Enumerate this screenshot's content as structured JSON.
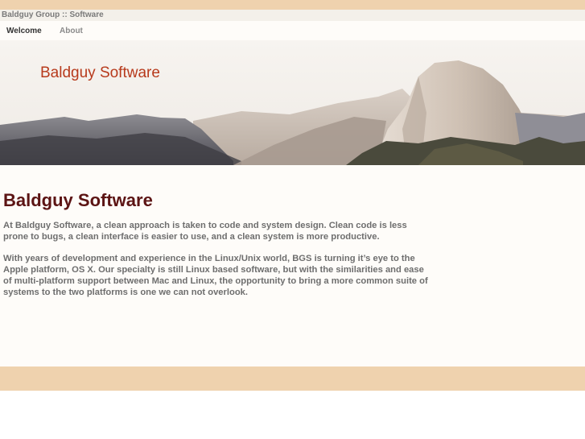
{
  "breadcrumb": "Baldguy Group :: Software",
  "nav": {
    "items": [
      "Welcome",
      "About"
    ]
  },
  "banner": {
    "title": "Baldguy Software"
  },
  "main": {
    "heading": "Baldguy Software",
    "paragraphs": [
      "At Baldguy Software, a clean approach is taken to code and system design. Clean code is less prone to bugs, a clean interface is easier to use, and a clean system is more productive.",
      "With years of development and experience in the Linux/Unix world, BGS is turning it’s eye to the Apple platform, OS X. Our specialty is still Linux based software, but with the similarities and ease of multi-platform support between Mac and Linux, the opportunity to bring a more common suite of systems to the two platforms is one we can not overlook."
    ]
  },
  "colors": {
    "stripe": "#efd2ae",
    "banner_title": "#b73a1c",
    "heading": "#5c1414"
  }
}
